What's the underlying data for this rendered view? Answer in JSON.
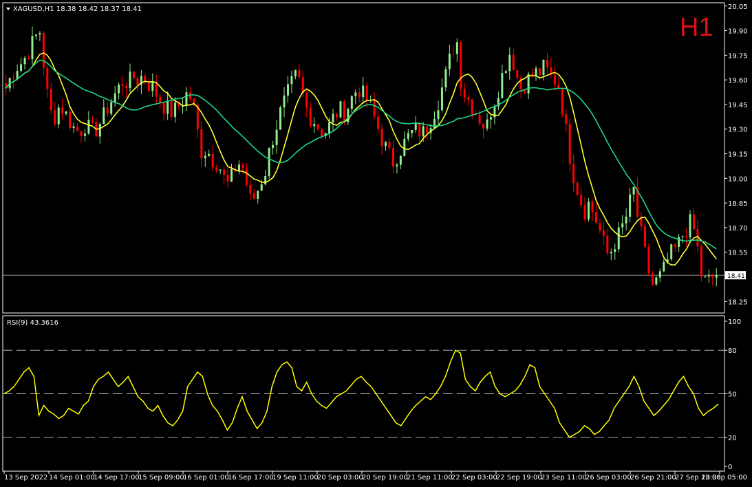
{
  "symbol_info": "XAGUSD,H1  18.38 18.42 18.37 18.41",
  "timeframe_label": "H1",
  "price_tag": "18.41",
  "rsi_label": "RSI(9) 43.3616",
  "colors": {
    "background": "#000000",
    "frame": "#ffffff",
    "bull_candle": "#90ee90",
    "bear_candle": "#ff0000",
    "ma_fast": "#ffff33",
    "ma_slow": "#1fd58a",
    "rsi": "#ffff00",
    "timeframe": "#e01010"
  },
  "chart_data": [
    {
      "type": "candlestick",
      "series": [
        {
          "name": "price",
          "shape": [
            19.55,
            19.62,
            19.68,
            19.7,
            19.74,
            19.8,
            19.86,
            19.9,
            19.6,
            19.4,
            19.38,
            19.45,
            19.4,
            19.35,
            19.3,
            19.28,
            19.33,
            19.3,
            19.28,
            19.33,
            19.38,
            19.45,
            19.5,
            19.55,
            19.6,
            19.58,
            19.62,
            19.6,
            19.63,
            19.58,
            19.55,
            19.5,
            19.45,
            19.42,
            19.4,
            19.43,
            19.47,
            19.52,
            19.48,
            19.3,
            19.15,
            19.18,
            19.12,
            19.1,
            19.05,
            18.95,
            19.0,
            19.08,
            19.1,
            18.98,
            18.85,
            18.9,
            18.98,
            19.05,
            19.2,
            19.3,
            19.4,
            19.48,
            19.55,
            19.62,
            19.58,
            19.45,
            19.38,
            19.35,
            19.3,
            19.28,
            19.32,
            19.38,
            19.42,
            19.4,
            19.45,
            19.52,
            19.55,
            19.5,
            19.47,
            19.38,
            19.3,
            19.22,
            19.15,
            19.1,
            19.15,
            19.2,
            19.25,
            19.28,
            19.3,
            19.27,
            19.32,
            19.38,
            19.45,
            19.55,
            19.65,
            19.78,
            19.85,
            19.55,
            19.5,
            19.45,
            19.4,
            19.35,
            19.3,
            19.42,
            19.5,
            19.6,
            19.7,
            19.78,
            19.65,
            19.55,
            19.58,
            19.62,
            19.64,
            19.65,
            19.68,
            19.62,
            19.6,
            19.55,
            19.35,
            19.15,
            19.0,
            18.9,
            18.8,
            18.85,
            18.78,
            18.7,
            18.6,
            18.52,
            18.6,
            18.65,
            18.72,
            18.8,
            18.95,
            18.75,
            18.6,
            18.45,
            18.35,
            18.38,
            18.42,
            18.5,
            18.55,
            18.58,
            18.65,
            18.7,
            18.74,
            18.6,
            18.4,
            18.36,
            18.39,
            18.41
          ]
        },
        {
          "name": "MA fast",
          "color": "ma_fast"
        },
        {
          "name": "MA slow",
          "color": "ma_slow"
        }
      ],
      "y_ticks": [
        "20.05",
        "19.90",
        "19.75",
        "19.60",
        "19.45",
        "19.30",
        "19.15",
        "19.00",
        "18.85",
        "18.70",
        "18.55",
        "18.41",
        "18.25"
      ],
      "ylim": [
        18.18,
        20.07
      ],
      "current_price": 18.41
    },
    {
      "type": "line",
      "series": [
        {
          "name": "RSI(9)",
          "values": [
            50,
            52,
            55,
            60,
            65,
            68,
            62,
            35,
            42,
            38,
            36,
            33,
            35,
            40,
            38,
            36,
            42,
            45,
            55,
            60,
            62,
            65,
            60,
            55,
            58,
            62,
            55,
            48,
            45,
            40,
            38,
            42,
            35,
            30,
            28,
            32,
            38,
            55,
            60,
            65,
            62,
            50,
            42,
            38,
            32,
            25,
            30,
            40,
            48,
            38,
            32,
            26,
            30,
            38,
            55,
            65,
            70,
            72,
            68,
            55,
            52,
            58,
            50,
            45,
            42,
            40,
            44,
            48,
            50,
            52,
            56,
            60,
            62,
            58,
            55,
            50,
            45,
            40,
            35,
            30,
            28,
            33,
            38,
            42,
            45,
            48,
            46,
            50,
            55,
            62,
            72,
            80,
            78,
            60,
            55,
            52,
            58,
            62,
            65,
            55,
            50,
            48,
            50,
            52,
            56,
            62,
            70,
            68,
            55,
            50,
            45,
            40,
            30,
            25,
            20,
            22,
            24,
            28,
            26,
            22,
            24,
            28,
            32,
            40,
            45,
            50,
            55,
            62,
            55,
            45,
            40,
            35,
            38,
            42,
            46,
            52,
            58,
            62,
            55,
            50,
            40,
            35,
            38,
            40,
            43
          ]
        }
      ],
      "y_ticks": [
        "100",
        "80",
        "50",
        "20",
        "0"
      ],
      "levels": [
        80,
        50,
        20
      ],
      "ylim": [
        0,
        100
      ]
    }
  ],
  "x_ticks": [
    "13 Sep 2022",
    "14 Sep 01:00",
    "14 Sep 17:00",
    "15 Sep 09:00",
    "16 Sep 01:00",
    "16 Sep 17:00",
    "19 Sep 11:00",
    "20 Sep 03:00",
    "20 Sep 19:00",
    "21 Sep 11:00",
    "22 Sep 03:00",
    "22 Sep 19:00",
    "23 Sep 11:00",
    "26 Sep 03:00",
    "26 Sep 21:00",
    "27 Sep 13:00",
    "28 Sep 05:00"
  ]
}
